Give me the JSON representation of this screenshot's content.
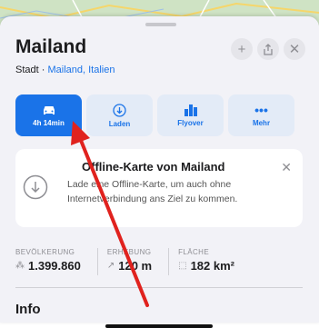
{
  "place": {
    "title": "Mailand",
    "subtitle_prefix": "Stadt · ",
    "subtitle_link": "Mailand, Italien"
  },
  "header_buttons": {
    "add_icon": "plus-icon",
    "share_icon": "share-icon",
    "close_icon": "close-icon"
  },
  "actions": [
    {
      "label": "4h 14min",
      "icon": "car-icon",
      "primary": true
    },
    {
      "label": "Laden",
      "icon": "download-icon"
    },
    {
      "label": "Flyover",
      "icon": "buildings-icon"
    },
    {
      "label": "Mehr",
      "icon": "ellipsis-icon"
    }
  ],
  "offline_card": {
    "title": "Offline-Karte von Mailand",
    "text": "Lade eine Offline-Karte, um auch ohne Internetverbindung ans Ziel zu kommen.",
    "icon": "download-circle-icon"
  },
  "stats": [
    {
      "label": "BEVÖLKERUNG",
      "value": "1.399.860",
      "icon": "people-icon"
    },
    {
      "label": "ERHEBUNG",
      "value": "120 m",
      "icon": "elevation-arrow-icon"
    },
    {
      "label": "FLÄCHE",
      "value": "182 km²",
      "icon": "area-icon"
    }
  ],
  "section": {
    "info": "Info"
  },
  "colors": {
    "accent": "#1a73e8",
    "annotation_arrow": "#e0221e"
  }
}
